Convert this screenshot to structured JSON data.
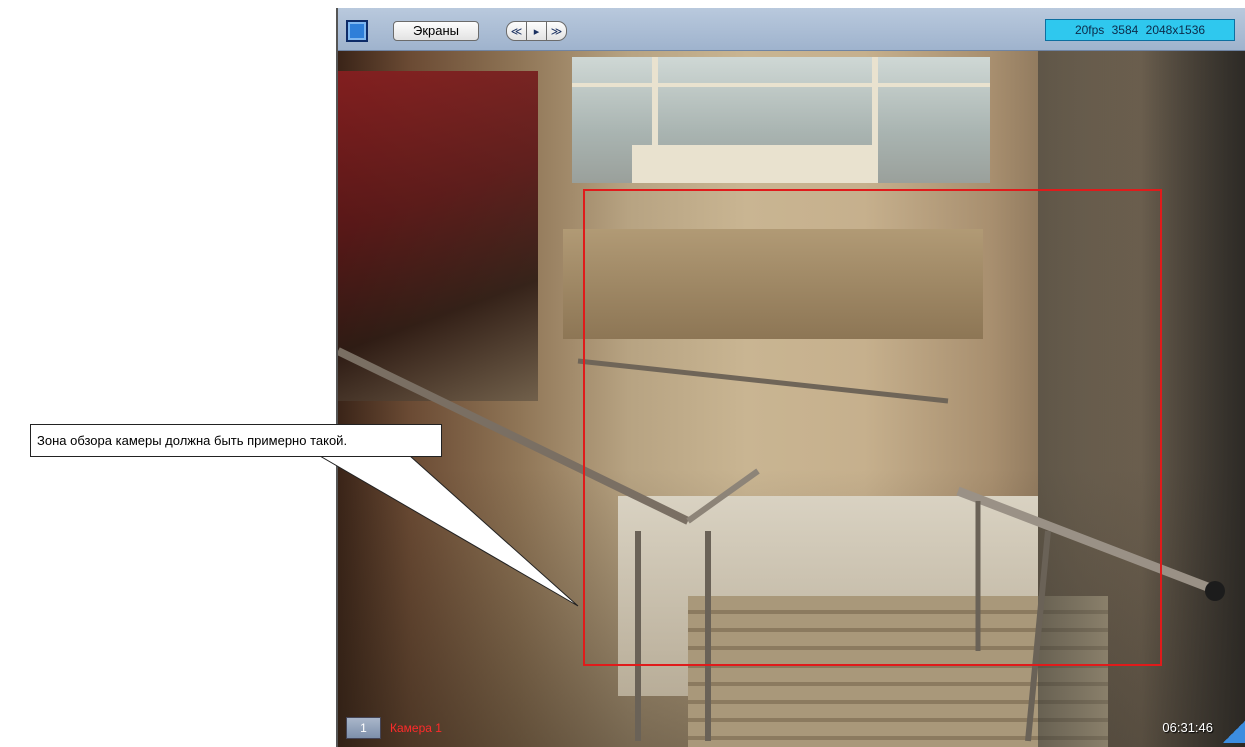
{
  "toolbar": {
    "screens_label": "Экраны",
    "nav_prev": "≪",
    "nav_play": "▸",
    "nav_next": "≫",
    "stream_info": "20fps 3584 2048x1536"
  },
  "camera": {
    "number": "1",
    "name": "Камера 1",
    "time": "06:31:46"
  },
  "callout": {
    "text": "Зона обзора камеры должна быть примерно такой."
  },
  "colors": {
    "zone": "#e01b1b",
    "camera_name": "#ff2a2a",
    "stream_badge": "#2fc8ee",
    "toolbar": "#b9c9dd"
  },
  "icons": [
    "layout-square-icon",
    "rewind-icon",
    "play-icon",
    "fast-forward-icon",
    "corner-resize-icon"
  ]
}
